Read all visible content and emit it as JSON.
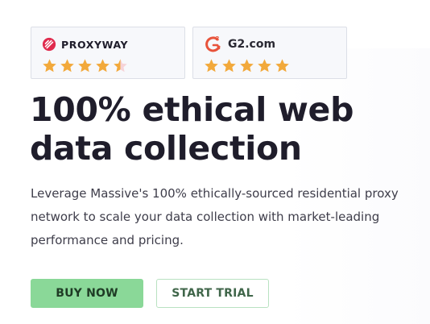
{
  "ratings": {
    "proxyway": {
      "name": "PROXYWAY",
      "stars": 4.5,
      "max": 5
    },
    "g2": {
      "name": "G2.com",
      "stars": 5,
      "max": 5
    }
  },
  "colors": {
    "star": "#f2a93b",
    "accent_green": "#8ad898",
    "heading": "#1f1d2b"
  },
  "hero": {
    "title_line1": "100% ethical web",
    "title_line2": "data collection",
    "subtitle": "Leverage Massive's 100% ethically-sourced residential proxy network to scale your data collection with market-leading performance and pricing."
  },
  "actions": {
    "buy_label": "BUY NOW",
    "trial_label": "START TRIAL"
  }
}
